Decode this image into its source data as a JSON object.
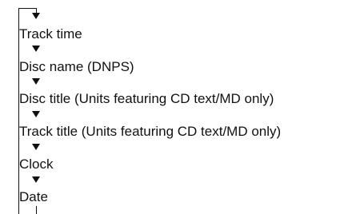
{
  "items": [
    "Track time",
    "Disc name (DNPS)",
    "Disc title (Units featuring CD text/MD only)",
    "Track title (Units featuring CD text/MD only)",
    "Clock",
    "Date"
  ]
}
